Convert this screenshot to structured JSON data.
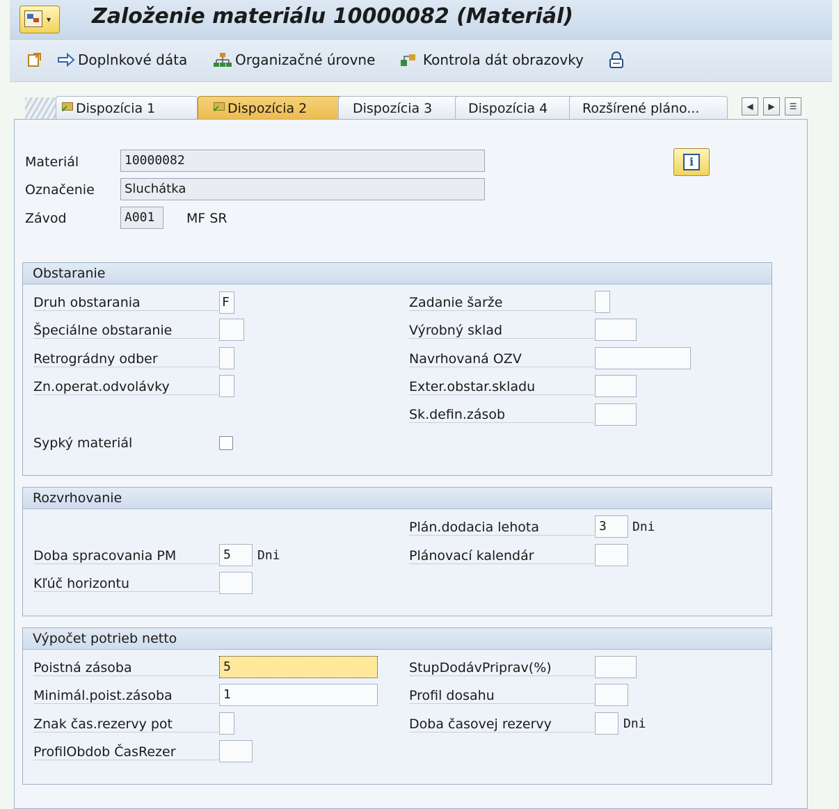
{
  "window": {
    "title": "Založenie materiálu 10000082 (Materiál)"
  },
  "toolbar": {
    "additional_data": "Doplnkové dáta",
    "org_levels": "Organizačné úrovne",
    "check_screen": "Kontrola dát obrazovky"
  },
  "tabs": [
    {
      "label": "Dispozícia 1",
      "checked": true
    },
    {
      "label": "Dispozícia 2",
      "checked": true,
      "active": true
    },
    {
      "label": "Dispozícia 3"
    },
    {
      "label": "Dispozícia 4"
    },
    {
      "label": "Rozšírené pláno..."
    }
  ],
  "header": {
    "material_label": "Materiál",
    "material_value": "10000082",
    "description_label": "Označenie",
    "description_value": "Sluchátka",
    "plant_label": "Závod",
    "plant_value": "A001",
    "plant_name": "MF SR"
  },
  "procurement": {
    "title": "Obstaranie",
    "proc_type_label": "Druh obstarania",
    "proc_type_value": "F",
    "special_proc_label": "Špeciálne obstaranie",
    "special_proc_value": "",
    "backflush_label": "Retrográdny odber",
    "backflush_value": "",
    "jit_label": "Zn.operat.odvolávky",
    "jit_value": "",
    "bulk_label": "Sypký materiál",
    "bulk_checked": false,
    "batch_entry_label": "Zadanie šarže",
    "batch_entry_value": "",
    "prod_storage_label": "Výrobný sklad",
    "prod_storage_value": "",
    "proposed_supply_label": "Navrhovaná OZV",
    "proposed_supply_value": "",
    "ext_storage_label": "Exter.obstar.skladu",
    "ext_storage_value": "",
    "stock_det_label": "Sk.defin.zásob",
    "stock_det_value": ""
  },
  "scheduling": {
    "title": "Rozvrhovanie",
    "gr_time_label": "Doba spracovania PM",
    "gr_time_value": "5",
    "gr_time_unit": "Dni",
    "horizon_label": "Kľúč horizontu",
    "horizon_value": "",
    "planned_delivery_label": "Plán.dodacia lehota",
    "planned_delivery_value": "3",
    "planned_delivery_unit": "Dni",
    "calendar_label": "Plánovací kalendár",
    "calendar_value": ""
  },
  "net_req": {
    "title": "Výpočet potrieb netto",
    "safety_stock_label": "Poistná zásoba",
    "safety_stock_value": "5",
    "min_safety_label": "Minimál.poist.zásoba",
    "min_safety_value": "1",
    "safety_time_ind_label": "Znak čas.rezervy pot",
    "safety_time_ind_value": "",
    "safety_time_profile_label": "ProfilObdob ČasRezer",
    "safety_time_profile_value": "",
    "service_level_label": "StupDodávPriprav(%)",
    "service_level_value": "",
    "coverage_profile_label": "Profil dosahu",
    "coverage_profile_value": "",
    "safety_time_label": "Doba časovej rezervy",
    "safety_time_value": "",
    "safety_time_unit": "Dni"
  }
}
